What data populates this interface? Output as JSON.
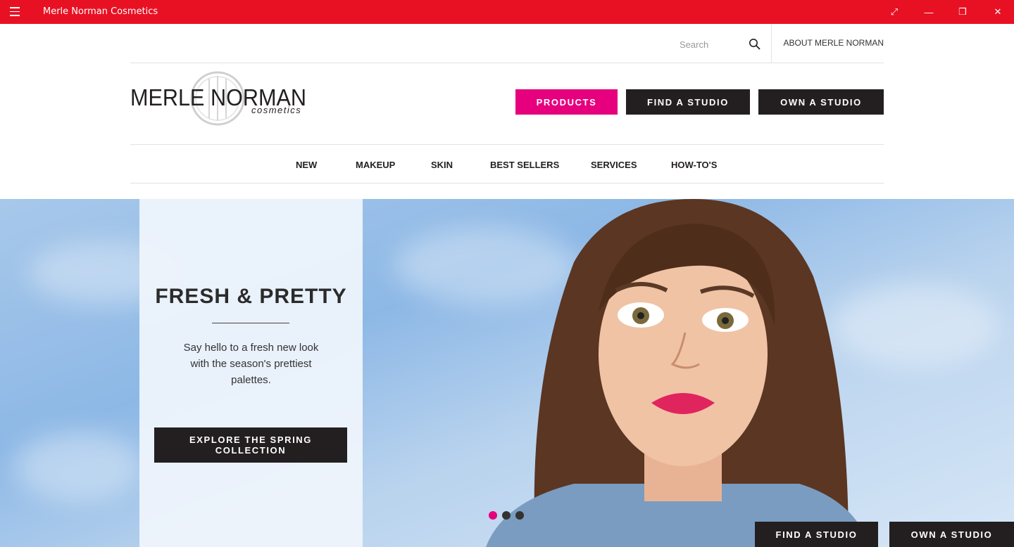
{
  "window": {
    "title": "Merle Norman Cosmetics",
    "controls": {
      "fullscreen": "⤢",
      "minimize": "—",
      "restore": "❐",
      "close": "✕"
    }
  },
  "colors": {
    "titlebar": "#e81123",
    "accent": "#e6007e",
    "dark": "#231f20"
  },
  "utility": {
    "search_placeholder": "Search",
    "about_label": "ABOUT MERLE NORMAN"
  },
  "logo": {
    "brand": "MERLE NORMAN",
    "sub": "cosmetics"
  },
  "cta": {
    "products": "PRODUCTS",
    "find_studio": "FIND A STUDIO",
    "own_studio": "OWN A STUDIO"
  },
  "nav": [
    {
      "label": "NEW"
    },
    {
      "label": "MAKEUP"
    },
    {
      "label": "SKIN"
    },
    {
      "label": "BEST SELLERS"
    },
    {
      "label": "SERVICES"
    },
    {
      "label": "HOW-TO'S"
    }
  ],
  "hero": {
    "title": "FRESH & PRETTY",
    "body": "Say hello to a fresh new look with the season's prettiest palettes.",
    "button": "EXPLORE THE SPRING COLLECTION",
    "slides_count": 3,
    "active_slide": 1
  },
  "floating": {
    "find_studio": "FIND A STUDIO",
    "own_studio": "OWN A STUDIO"
  }
}
